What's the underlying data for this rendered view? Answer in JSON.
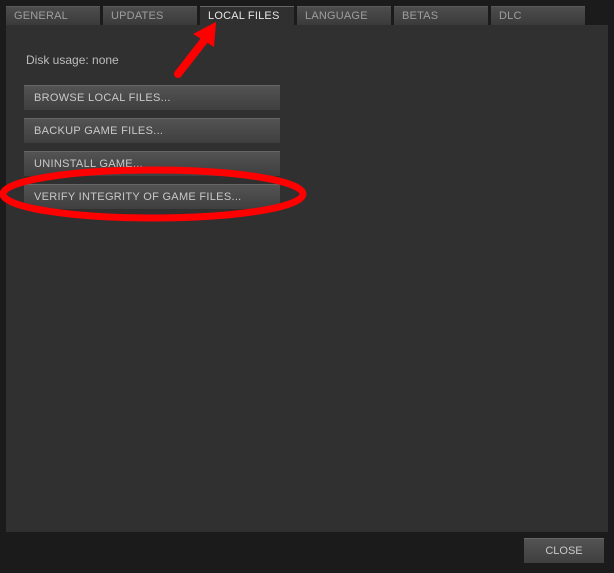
{
  "tabs": [
    {
      "label": "GENERAL",
      "active": false
    },
    {
      "label": "UPDATES",
      "active": false
    },
    {
      "label": "LOCAL FILES",
      "active": true
    },
    {
      "label": "LANGUAGE",
      "active": false
    },
    {
      "label": "BETAS",
      "active": false
    },
    {
      "label": "DLC",
      "active": false
    }
  ],
  "disk_usage_label": "Disk usage: none",
  "buttons": {
    "browse": "BROWSE LOCAL FILES...",
    "backup": "BACKUP GAME FILES...",
    "uninstall": "UNINSTALL GAME...",
    "verify": "VERIFY INTEGRITY OF GAME FILES..."
  },
  "footer": {
    "close_label": "CLOSE"
  },
  "annotation": {
    "arrow_points_to": "tab-local-files",
    "circle_highlights": "verify-integrity-button"
  }
}
